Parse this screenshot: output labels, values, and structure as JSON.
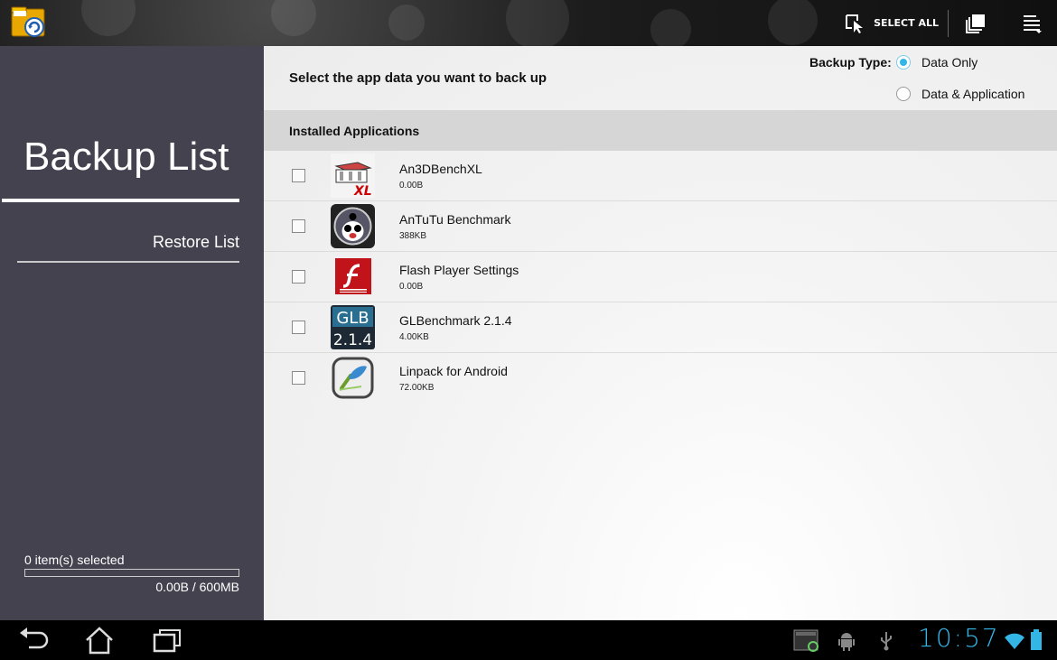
{
  "actionbar": {
    "app_icon": "backup-folder-icon",
    "select_all_label": "SELECT ALL",
    "icons": [
      "select-all-icon",
      "copy-icon",
      "overflow-menu-icon"
    ]
  },
  "sidebar": {
    "title": "Backup List",
    "restore_label": "Restore List",
    "selected_count": "0 item(s) selected",
    "capacity": "0.00B / 600MB",
    "progress_fraction": 0
  },
  "main": {
    "prompt": "Select the app data you want to back up",
    "backup_type_label": "Backup Type:",
    "options": [
      {
        "label": "Data Only",
        "selected": true
      },
      {
        "label": "Data & Application",
        "selected": false
      }
    ],
    "section_header": "Installed Applications",
    "apps": [
      {
        "name": "An3DBenchXL",
        "size": "0.00B",
        "icon": "an3dbench-icon",
        "checked": false
      },
      {
        "name": "AnTuTu Benchmark",
        "size": "388KB",
        "icon": "antutu-icon",
        "checked": false
      },
      {
        "name": "Flash Player Settings",
        "size": "0.00B",
        "icon": "flash-player-icon",
        "checked": false
      },
      {
        "name": "GLBenchmark 2.1.4",
        "size": "4.00KB",
        "icon": "glbenchmark-icon",
        "checked": false
      },
      {
        "name": "Linpack for Android",
        "size": "72.00KB",
        "icon": "linpack-icon",
        "checked": false
      }
    ],
    "glb_icon_text": [
      "GLB",
      "2.1.4"
    ]
  },
  "systembar": {
    "clock": "10:57",
    "nav_icons": [
      "back-icon",
      "home-icon",
      "recent-apps-icon"
    ],
    "status_icons": [
      "screenshot-icon",
      "android-debug-icon",
      "usb-icon",
      "wifi-icon",
      "battery-icon"
    ],
    "accent_color": "#33b5e5"
  }
}
